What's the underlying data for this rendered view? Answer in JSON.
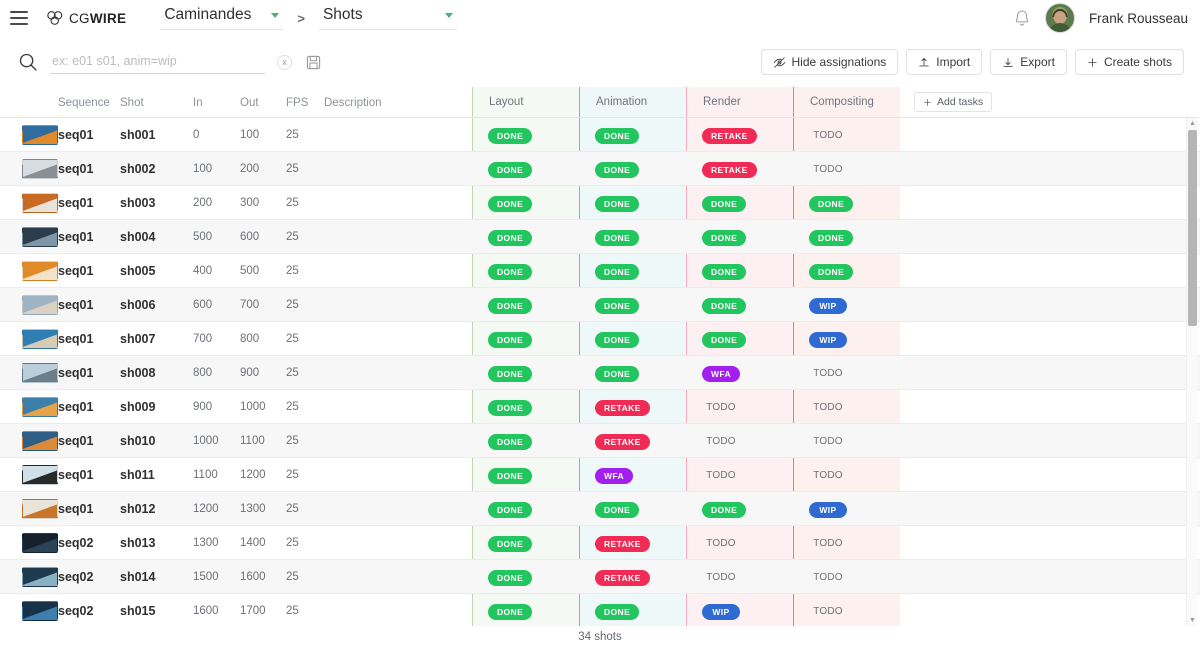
{
  "header": {
    "menu_icon": "hamburger-icon",
    "logo_light": "CG",
    "logo_bold": "WIRE",
    "breadcrumb": [
      {
        "label": "Caminandes",
        "icon": "chevron-down-icon"
      },
      {
        "label": "Shots",
        "icon": "chevron-down-icon"
      }
    ],
    "separator": ">",
    "bell_icon": "bell-icon",
    "user_name": "Frank Rousseau",
    "avatar": "user-avatar"
  },
  "search": {
    "icon": "search-icon",
    "placeholder": "ex: e01 s01, anim=wip",
    "value": "",
    "clear_label": "x",
    "save_icon": "save-search-icon"
  },
  "toolbar": {
    "buttons": [
      {
        "label": "Hide assignations",
        "icon": "eye-off-icon"
      },
      {
        "label": "Import",
        "icon": "upload-icon"
      },
      {
        "label": "Export",
        "icon": "download-icon"
      },
      {
        "label": "Create shots",
        "icon": "plus-icon"
      }
    ]
  },
  "table": {
    "columns": [
      {
        "key": "thumb",
        "label": ""
      },
      {
        "key": "sequence",
        "label": "Sequence"
      },
      {
        "key": "shot",
        "label": "Shot"
      },
      {
        "key": "in",
        "label": "In"
      },
      {
        "key": "out",
        "label": "Out"
      },
      {
        "key": "fps",
        "label": "FPS"
      },
      {
        "key": "description",
        "label": "Description"
      }
    ],
    "task_columns": [
      {
        "key": "layout",
        "label": "Layout",
        "accent": "#bcd9b4",
        "tint": "#f4faf3"
      },
      {
        "key": "animation",
        "label": "Animation",
        "accent": "#62c7c0",
        "tint": "#eef8f8"
      },
      {
        "key": "render",
        "label": "Render",
        "accent": "#f0aab6",
        "tint": "#fdf0f2"
      },
      {
        "key": "compositing",
        "label": "Compositing",
        "accent": "#e87f74",
        "tint": "#fdf1ef"
      }
    ],
    "add_tasks_label": "Add tasks",
    "add_tasks_icon": "plus-icon",
    "status_colors": {
      "DONE": "#22c55e",
      "RETAKE": "#f02b55",
      "WIP": "#2e6ad1",
      "WFA": "#a21ff0",
      "TODO": "transparent"
    },
    "rows": [
      {
        "thumb": "#2e6d9e",
        "thumb2": "#e08a2a",
        "sequence": "seq01",
        "shot": "sh001",
        "in": "0",
        "out": "100",
        "fps": "25",
        "description": "",
        "layout": "DONE",
        "animation": "DONE",
        "render": "RETAKE",
        "compositing": "TODO"
      },
      {
        "thumb": "#d6dde2",
        "thumb2": "#8a8f93",
        "sequence": "seq01",
        "shot": "sh002",
        "in": "100",
        "out": "200",
        "fps": "25",
        "description": "",
        "layout": "DONE",
        "animation": "DONE",
        "render": "RETAKE",
        "compositing": "TODO"
      },
      {
        "thumb": "#c96a25",
        "thumb2": "#e8e2d8",
        "sequence": "seq01",
        "shot": "sh003",
        "in": "200",
        "out": "300",
        "fps": "25",
        "description": "",
        "layout": "DONE",
        "animation": "DONE",
        "render": "DONE",
        "compositing": "DONE"
      },
      {
        "thumb": "#2b3d4d",
        "thumb2": "#7e97a8",
        "sequence": "seq01",
        "shot": "sh004",
        "in": "500",
        "out": "600",
        "fps": "25",
        "description": "",
        "layout": "DONE",
        "animation": "DONE",
        "render": "DONE",
        "compositing": "DONE"
      },
      {
        "thumb": "#e08a2a",
        "thumb2": "#f2e3c8",
        "sequence": "seq01",
        "shot": "sh005",
        "in": "400",
        "out": "500",
        "fps": "25",
        "description": "",
        "layout": "DONE",
        "animation": "DONE",
        "render": "DONE",
        "compositing": "DONE"
      },
      {
        "thumb": "#9db4c4",
        "thumb2": "#d9d2c4",
        "sequence": "seq01",
        "shot": "sh006",
        "in": "600",
        "out": "700",
        "fps": "25",
        "description": "",
        "layout": "DONE",
        "animation": "DONE",
        "render": "DONE",
        "compositing": "WIP"
      },
      {
        "thumb": "#2f7fb5",
        "thumb2": "#d7cbb4",
        "sequence": "seq01",
        "shot": "sh007",
        "in": "700",
        "out": "800",
        "fps": "25",
        "description": "",
        "layout": "DONE",
        "animation": "DONE",
        "render": "DONE",
        "compositing": "WIP"
      },
      {
        "thumb": "#b9cfdd",
        "thumb2": "#6d7e88",
        "sequence": "seq01",
        "shot": "sh008",
        "in": "800",
        "out": "900",
        "fps": "25",
        "description": "",
        "layout": "DONE",
        "animation": "DONE",
        "render": "WFA",
        "compositing": "TODO"
      },
      {
        "thumb": "#3d7fa8",
        "thumb2": "#e6a24a",
        "sequence": "seq01",
        "shot": "sh009",
        "in": "900",
        "out": "1000",
        "fps": "25",
        "description": "",
        "layout": "DONE",
        "animation": "RETAKE",
        "render": "TODO",
        "compositing": "TODO"
      },
      {
        "thumb": "#2f5f86",
        "thumb2": "#d98b3a",
        "sequence": "seq01",
        "shot": "sh010",
        "in": "1000",
        "out": "1100",
        "fps": "25",
        "description": "",
        "layout": "DONE",
        "animation": "RETAKE",
        "render": "TODO",
        "compositing": "TODO"
      },
      {
        "thumb": "#cfe0e8",
        "thumb2": "#2a2a2a",
        "sequence": "seq01",
        "shot": "sh011",
        "in": "1100",
        "out": "1200",
        "fps": "25",
        "description": "",
        "layout": "DONE",
        "animation": "WFA",
        "render": "TODO",
        "compositing": "TODO"
      },
      {
        "thumb": "#e8e4da",
        "thumb2": "#c9762a",
        "sequence": "seq01",
        "shot": "sh012",
        "in": "1200",
        "out": "1300",
        "fps": "25",
        "description": "",
        "layout": "DONE",
        "animation": "DONE",
        "render": "DONE",
        "compositing": "WIP"
      },
      {
        "thumb": "#15212e",
        "thumb2": "#2b4356",
        "sequence": "seq02",
        "shot": "sh013",
        "in": "1300",
        "out": "1400",
        "fps": "25",
        "description": "",
        "layout": "DONE",
        "animation": "RETAKE",
        "render": "TODO",
        "compositing": "TODO"
      },
      {
        "thumb": "#1d3a4f",
        "thumb2": "#8ab0c4",
        "sequence": "seq02",
        "shot": "sh014",
        "in": "1500",
        "out": "1600",
        "fps": "25",
        "description": "",
        "layout": "DONE",
        "animation": "RETAKE",
        "render": "TODO",
        "compositing": "TODO"
      },
      {
        "thumb": "#16324a",
        "thumb2": "#3f7fae",
        "sequence": "seq02",
        "shot": "sh015",
        "in": "1600",
        "out": "1700",
        "fps": "25",
        "description": "",
        "layout": "DONE",
        "animation": "DONE",
        "render": "WIP",
        "compositing": "TODO"
      }
    ]
  },
  "footer": {
    "count_label": "34 shots"
  },
  "scrollbar": {
    "up_icon": "caret-up-icon",
    "down_icon": "caret-down-icon"
  }
}
